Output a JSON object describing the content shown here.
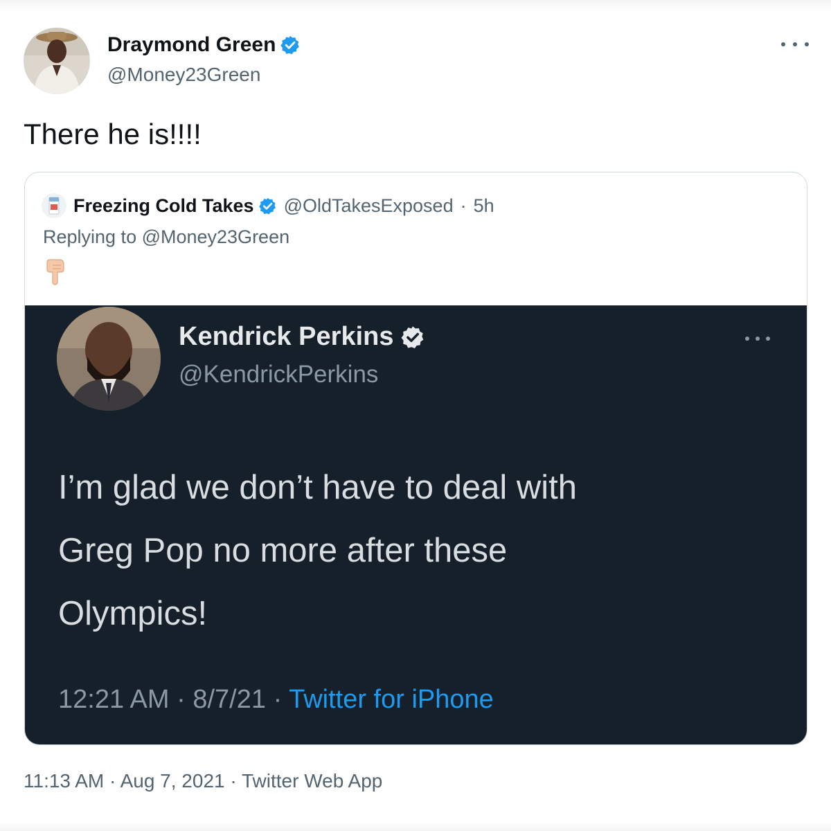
{
  "tweet": {
    "author_name": "Draymond Green",
    "author_handle": "@Money23Green",
    "text": "There he is!!!!",
    "timestamp": "11:13 AM",
    "date": "Aug 7, 2021",
    "source": "Twitter Web App",
    "sep": "·",
    "more_icon": "more-horizontal-icon",
    "verified_icon": "verified-badge-icon"
  },
  "quote": {
    "author_name": "Freezing Cold Takes",
    "author_handle": "@OldTakesExposed",
    "sep": "·",
    "time": "5h",
    "replying_to": "Replying to @Money23Green",
    "emoji_icon": "pointing-down-emoji-icon",
    "embedded": {
      "author_name": "Kendrick Perkins",
      "author_handle": "@KendrickPerkins",
      "text_lines": [
        "I’m glad we don’t have to deal with",
        "Greg Pop no more after these",
        "Olympics!"
      ],
      "time": "12:21 AM",
      "date": "8/7/21",
      "source": "Twitter for iPhone",
      "sep": "·"
    }
  },
  "colors": {
    "verified_blue": "#1d9bf0",
    "media_background": "#15202b",
    "secondary_text": "#536471"
  }
}
